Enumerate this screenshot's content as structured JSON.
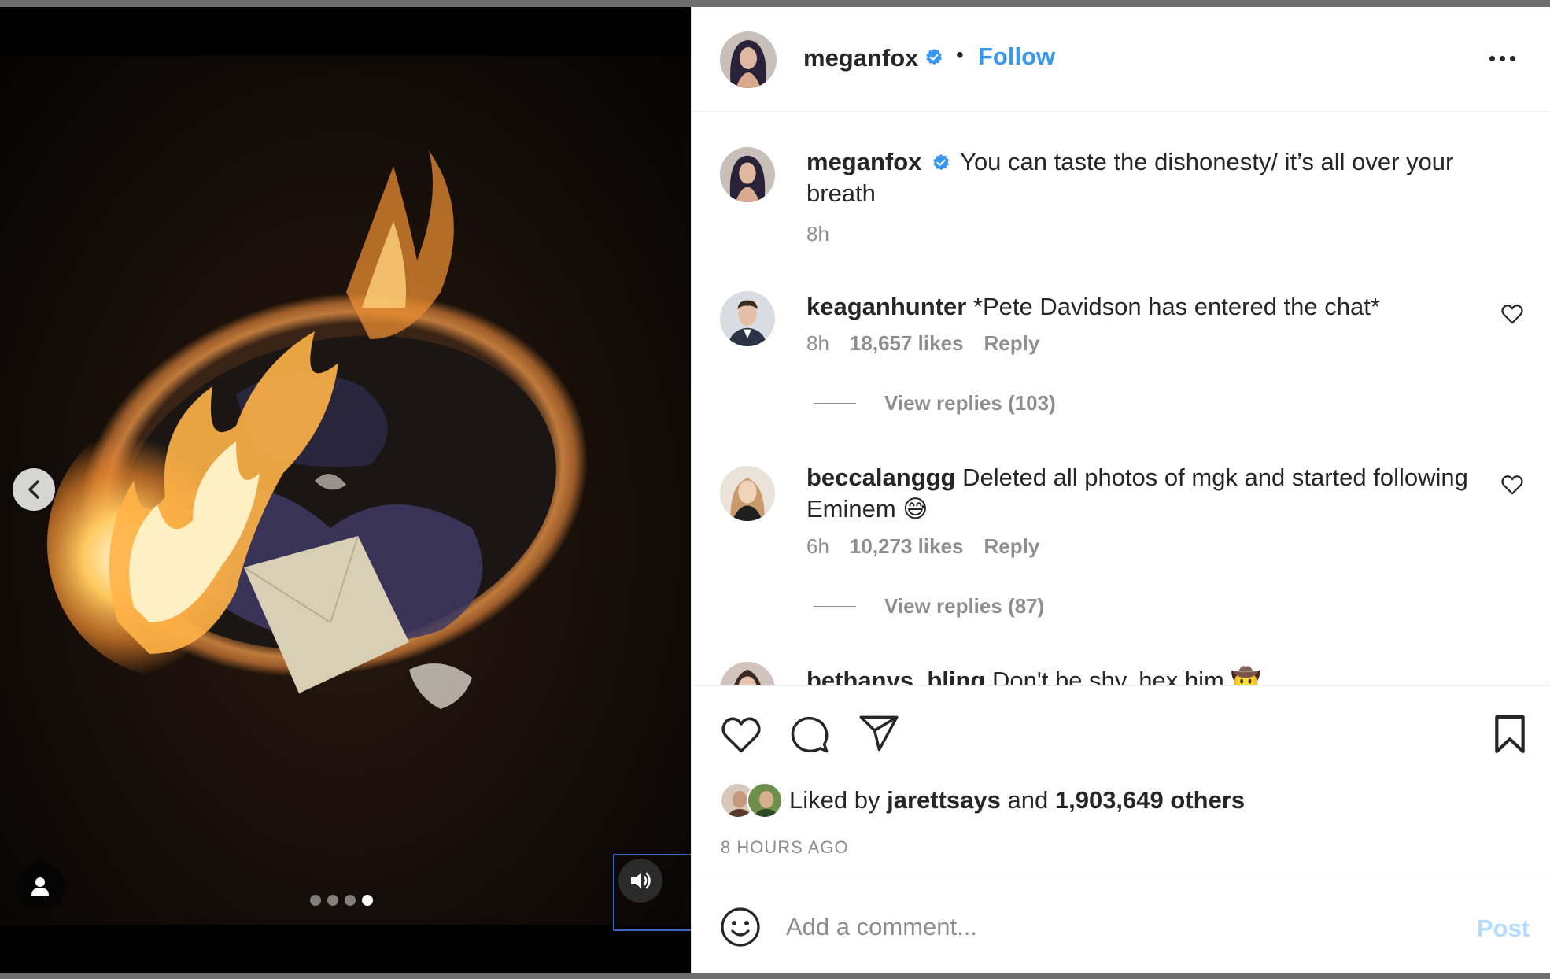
{
  "post": {
    "author": "meganfox",
    "follow_label": "Follow",
    "separator": "•",
    "caption": "You can taste the dishonesty/ it’s all over your breath",
    "caption_time": "8h"
  },
  "carousel": {
    "total": 4,
    "active_index": 4
  },
  "comments": [
    {
      "username": "keaganhunter",
      "text": "*Pete Davidson has entered the chat*",
      "time": "8h",
      "likes": "18,657 likes",
      "reply_label": "Reply",
      "view_replies": "View replies (103)"
    },
    {
      "username": "beccalanggg",
      "text": "Deleted all photos of mgk and started following Eminem 😅",
      "time": "6h",
      "likes": "10,273 likes",
      "reply_label": "Reply",
      "view_replies": "View replies (87)"
    },
    {
      "username": "bethanys_bling",
      "text": "Don't be shy, hex him 🤠"
    }
  ],
  "likes": {
    "prefix": "Liked by",
    "liker": "jarettsays",
    "conjunction": "and",
    "others": "1,903,649 others"
  },
  "time_ago": "8 HOURS AGO",
  "comment_box": {
    "placeholder": "Add a comment...",
    "post_label": "Post"
  },
  "colors": {
    "accent": "#3897f0",
    "post_disabled": "#b3dbff",
    "verified": "#3897f0",
    "muted_text": "#8e8e8e"
  },
  "icons": [
    "chevron-left-icon",
    "user-tag-icon",
    "volume-icon",
    "verified-badge-icon",
    "more-icon",
    "heart-icon",
    "comment-icon",
    "share-icon",
    "bookmark-icon",
    "emoji-icon"
  ]
}
